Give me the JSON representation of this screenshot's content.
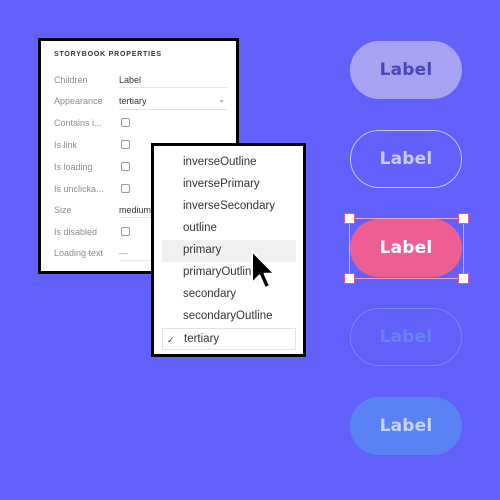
{
  "properties_panel": {
    "title": "STORYBOOK PROPERTIES",
    "rows": [
      {
        "label": "Children",
        "value": "Label"
      },
      {
        "label": "Appearance",
        "value": "tertiary",
        "chevron": "chevron-down-icon"
      },
      {
        "label": "Contains i..."
      },
      {
        "label": "Is link"
      },
      {
        "label": "Is loading"
      },
      {
        "label": "Is unclicka..."
      },
      {
        "label": "Size",
        "value": "medium"
      },
      {
        "label": "Is disabled"
      },
      {
        "label": "Loading text",
        "value": "—"
      }
    ]
  },
  "dropdown": {
    "options": [
      "inverseOutline",
      "inversePrimary",
      "inverseSecondary",
      "outline",
      "primary",
      "primaryOutline",
      "secondary",
      "secondaryOutline",
      "tertiary"
    ],
    "highlighted": "primary",
    "selected": "tertiary",
    "check_mark": "✓"
  },
  "buttons": {
    "b1": "Label",
    "b2": "Label",
    "b3": "Label",
    "b4": "Label",
    "b5": "Label"
  },
  "colors": {
    "background": "#6160fb",
    "selected_button": "#ed5f93",
    "selection_handle_border": "#e25a8b"
  }
}
